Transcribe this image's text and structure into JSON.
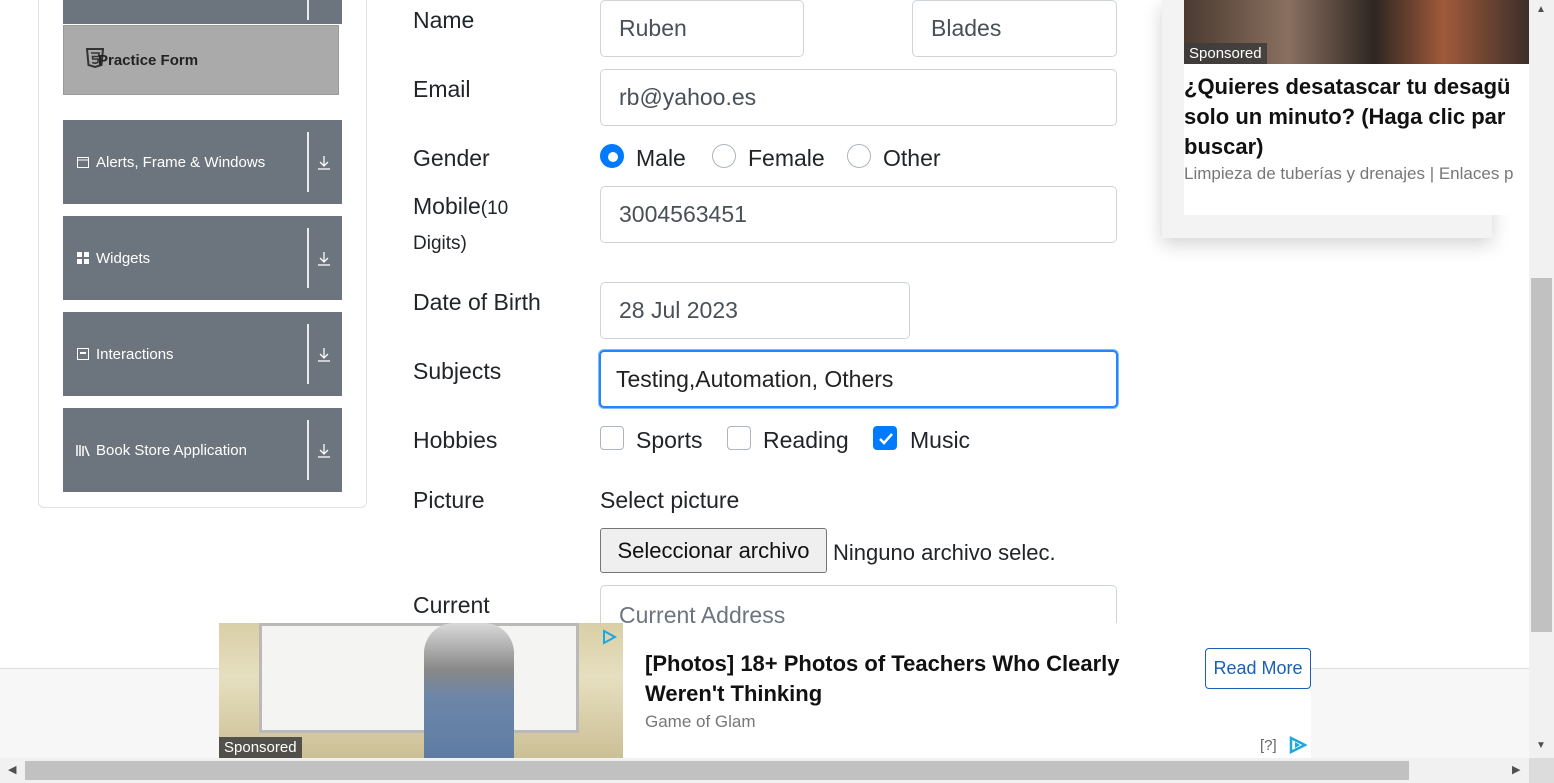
{
  "sidebar": {
    "practice_form": "Practice Form",
    "groups": [
      {
        "label": "Alerts, Frame & Windows",
        "icon": "window-icon"
      },
      {
        "label": "Widgets",
        "icon": "widgets-icon"
      },
      {
        "label": "Interactions",
        "icon": "interactions-icon"
      },
      {
        "label": "Book Store Application",
        "icon": "book-icon"
      }
    ]
  },
  "form": {
    "name_label": "Name",
    "first_name": "Ruben",
    "last_name": "Blades",
    "email_label": "Email",
    "email": "rb@yahoo.es",
    "gender_label": "Gender",
    "gender_options": [
      "Male",
      "Female",
      "Other"
    ],
    "gender_selected": "Male",
    "mobile_label": "Mobile",
    "mobile_hint": "(10",
    "mobile_hint2": "Digits)",
    "mobile": "3004563451",
    "dob_label": "Date of Birth",
    "dob": "28 Jul 2023",
    "subjects_label": "Subjects",
    "subjects": "Testing,Automation, Others",
    "hobbies_label": "Hobbies",
    "hobbies": [
      "Sports",
      "Reading",
      "Music"
    ],
    "hobbies_checked": [
      "Music"
    ],
    "picture_label": "Picture",
    "select_picture": "Select picture",
    "file_button": "Seleccionar archivo",
    "file_status": "Ninguno archivo selec.",
    "current_label": "Current",
    "address_placeholder": "Current Address"
  },
  "ad_top": {
    "sponsored": "Sponsored",
    "title": "¿Quieres desatascar tu desagü\nsolo un minuto? (Haga clic par\nbuscar)",
    "source": "Limpieza de tuberías y drenajes | Enlaces p"
  },
  "ad_bottom": {
    "sponsored": "Sponsored",
    "title": "[Photos] 18+ Photos of Teachers Who Clearly Weren't Thinking",
    "source": "Game of Glam",
    "read_more": "Read More",
    "ad_info": "[?]"
  },
  "colors": {
    "accent": "#007bff",
    "sidebar": "#6c757d",
    "focus": "#2684ff"
  }
}
